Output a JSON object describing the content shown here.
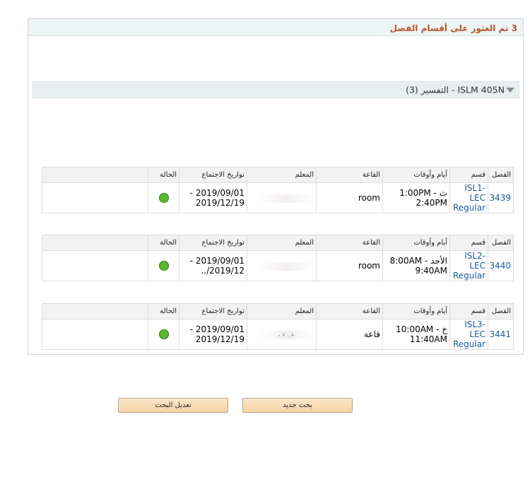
{
  "results": {
    "header": "3 تم العثور على أقسام الفصل"
  },
  "course": {
    "title": "ISLM 405N - التفسير (3)"
  },
  "table": {
    "headers": {
      "class": "الفصل",
      "section": "قسم",
      "days_times": "أيام وأوقات",
      "room": "القاعة",
      "instructor": "المعلم",
      "meeting_dates": "تواريخ الاجتماع",
      "status": "الحالة"
    },
    "rows": [
      {
        "class_nbr": "3439",
        "section_line1": "ISL1-LEC",
        "section_line2": "Regular",
        "days_line1": "ث - 1:00PM",
        "days_line2": "2:40PM",
        "room": "room",
        "instructor": "",
        "dates_line1": "2019/09/01 -",
        "dates_line2": "2019/12/19",
        "status": "open"
      },
      {
        "class_nbr": "3440",
        "section_line1": "ISL2-LEC",
        "section_line2": "Regular",
        "days_line1": "الأحد - 8:00AM",
        "days_line2": "9:40AM",
        "room": "room",
        "instructor": "",
        "dates_line1": "2019/09/01 -",
        "dates_line2": "2019/12/..",
        "status": "open"
      },
      {
        "class_nbr": "3441",
        "section_line1": "ISL3-LEC",
        "section_line2": "Regular",
        "days_line1": "خ - 10:00AM",
        "days_line2": "11:40AM",
        "room": "قاعة",
        "instructor": "ء . ء ،",
        "dates_line1": "2019/09/01 -",
        "dates_line2": "2019/12/19",
        "status": "open"
      }
    ]
  },
  "status_color": "#5cb82d",
  "accent_color": "#b2562b",
  "link_color": "#1f5b98",
  "buttons": {
    "new_search": "بحث جديد",
    "modify_search": "تعديل البحث"
  }
}
